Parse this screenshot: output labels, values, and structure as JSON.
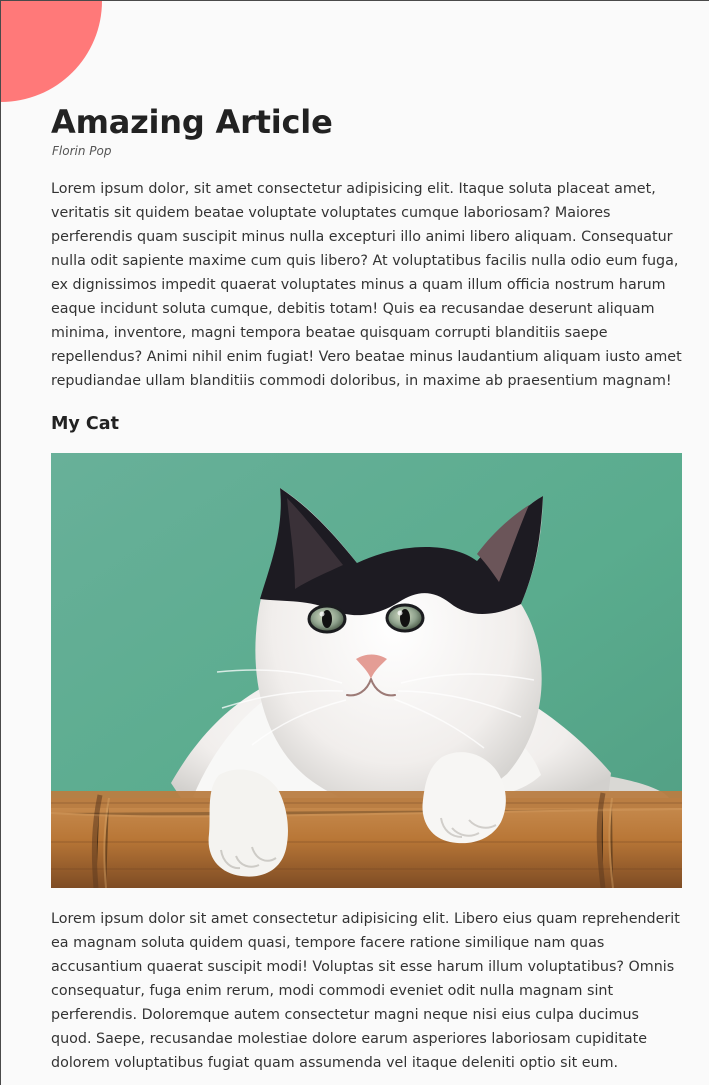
{
  "navigation": {
    "menu_icon": "hamburger-menu-icon",
    "accent_color": "#ff7979"
  },
  "article": {
    "title": "Amazing Article",
    "author": "Florin Pop",
    "intro_paragraph": "Lorem ipsum dolor, sit amet consectetur adipisicing elit. Itaque soluta placeat amet, veritatis sit quidem beatae voluptate voluptates cumque laboriosam? Maiores perferendis quam suscipit minus nulla excepturi illo animi libero aliquam. Consequatur nulla odit sapiente maxime cum quis libero? At voluptatibus facilis nulla odio eum fuga, ex dignissimos impedit quaerat voluptates minus a quam illum officia nostrum harum eaque incidunt soluta cumque, debitis totam! Quis ea recusandae deserunt aliquam minima, inventore, magni tempora beatae quisquam corrupti blanditiis saepe repellendus? Animi nihil enim fugiat! Vero beatae minus laudantium aliquam iusto amet repudiandae ullam blanditiis commodi doloribus, in maxime ab praesentium magnam!",
    "section_heading": "My Cat",
    "closing_paragraph": "Lorem ipsum dolor sit amet consectetur adipisicing elit. Libero eius quam reprehenderit ea magnam soluta quidem quasi, tempore facere ratione similique nam quas accusantium quaerat suscipit modi! Voluptas sit esse harum illum voluptatibus? Omnis consequatur, fuga enim rerum, modi commodi eveniet odit nulla magnam sint perferendis. Doloremque autem consectetur magni neque nisi eius culpa ducimus quod. Saepe, recusandae molestiae dolore earum asperiores laboriosam cupiditate dolorem voluptatibus fugiat quam assumenda vel itaque deleniti optio sit eum."
  }
}
